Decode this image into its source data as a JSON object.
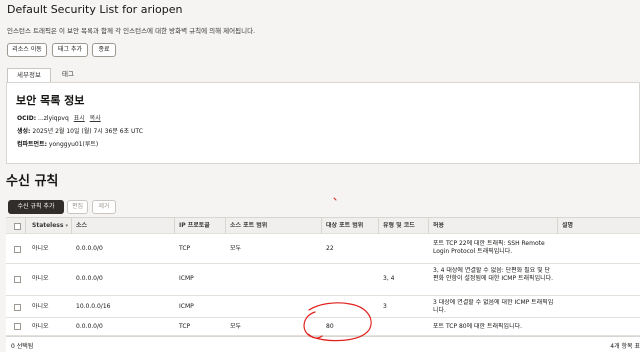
{
  "header": {
    "title": "Default Security List for ariopen",
    "subtitle": "인스턴스 트래픽은 이 보안 목록과 함께 각 인스턴스에 대한 방화벽 규칙에 의해 제어됩니다."
  },
  "actions": {
    "move": "리소스 이동",
    "add_tag": "태그 추가",
    "terminate": "종료"
  },
  "tabs": [
    {
      "label": "세부정보",
      "active": true
    },
    {
      "label": "태그",
      "active": false
    }
  ],
  "info": {
    "heading": "보안 목록 정보",
    "ocid_label": "OCID:",
    "ocid_value": "...zlyiqpvq",
    "show_link": "표시",
    "copy_link": "복사",
    "created_label": "생성:",
    "created_value": "2025년 2월 10일 (월) 7시 36분 6초 UTC",
    "compartment_label": "컴파트먼트:",
    "compartment_value": "yonggyu01(루트)"
  },
  "ingress": {
    "heading": "수신 규칙",
    "add_button": "수신 규칙 추가",
    "edit_button": "편집",
    "remove_button": "제거",
    "columns": [
      "Stateless",
      "소스",
      "IP 프로토콜",
      "소스 포트 범위",
      "대상 포트 범위",
      "유형 및 코드",
      "허용",
      "설명"
    ],
    "rows": [
      {
        "stateless": "아니오",
        "source": "0.0.0.0/0",
        "protocol": "TCP",
        "src_port": "모두",
        "dst_port": "22",
        "type_code": "",
        "allows": "포트 TCP 22에 대한 트래픽: SSH Remote Login Protocol 트래픽입니다.",
        "description": ""
      },
      {
        "stateless": "아니오",
        "source": "0.0.0.0/0",
        "protocol": "ICMP",
        "src_port": "",
        "dst_port": "",
        "type_code": "3, 4",
        "allows": "3, 4 대상에 연결할 수 없음: 단편화 필요 및 단편화 안함이 설정됨에 대한 ICMP 트래픽입니다.",
        "description": ""
      },
      {
        "stateless": "아니오",
        "source": "10.0.0.0/16",
        "protocol": "ICMP",
        "src_port": "",
        "dst_port": "",
        "type_code": "3",
        "allows": "3 대상에 연결할 수 없음에 대한 ICMP 트래픽입니다.",
        "description": ""
      },
      {
        "stateless": "아니오",
        "source": "0.0.0.0/0",
        "protocol": "TCP",
        "src_port": "모두",
        "dst_port": "80",
        "type_code": "",
        "allows": "포트 TCP 80에 대한 트래픽입니다.",
        "description": ""
      }
    ],
    "selected_text": "0 선택됨",
    "count_text": "4개 항목 표"
  },
  "annotation_color": "#e0201c"
}
